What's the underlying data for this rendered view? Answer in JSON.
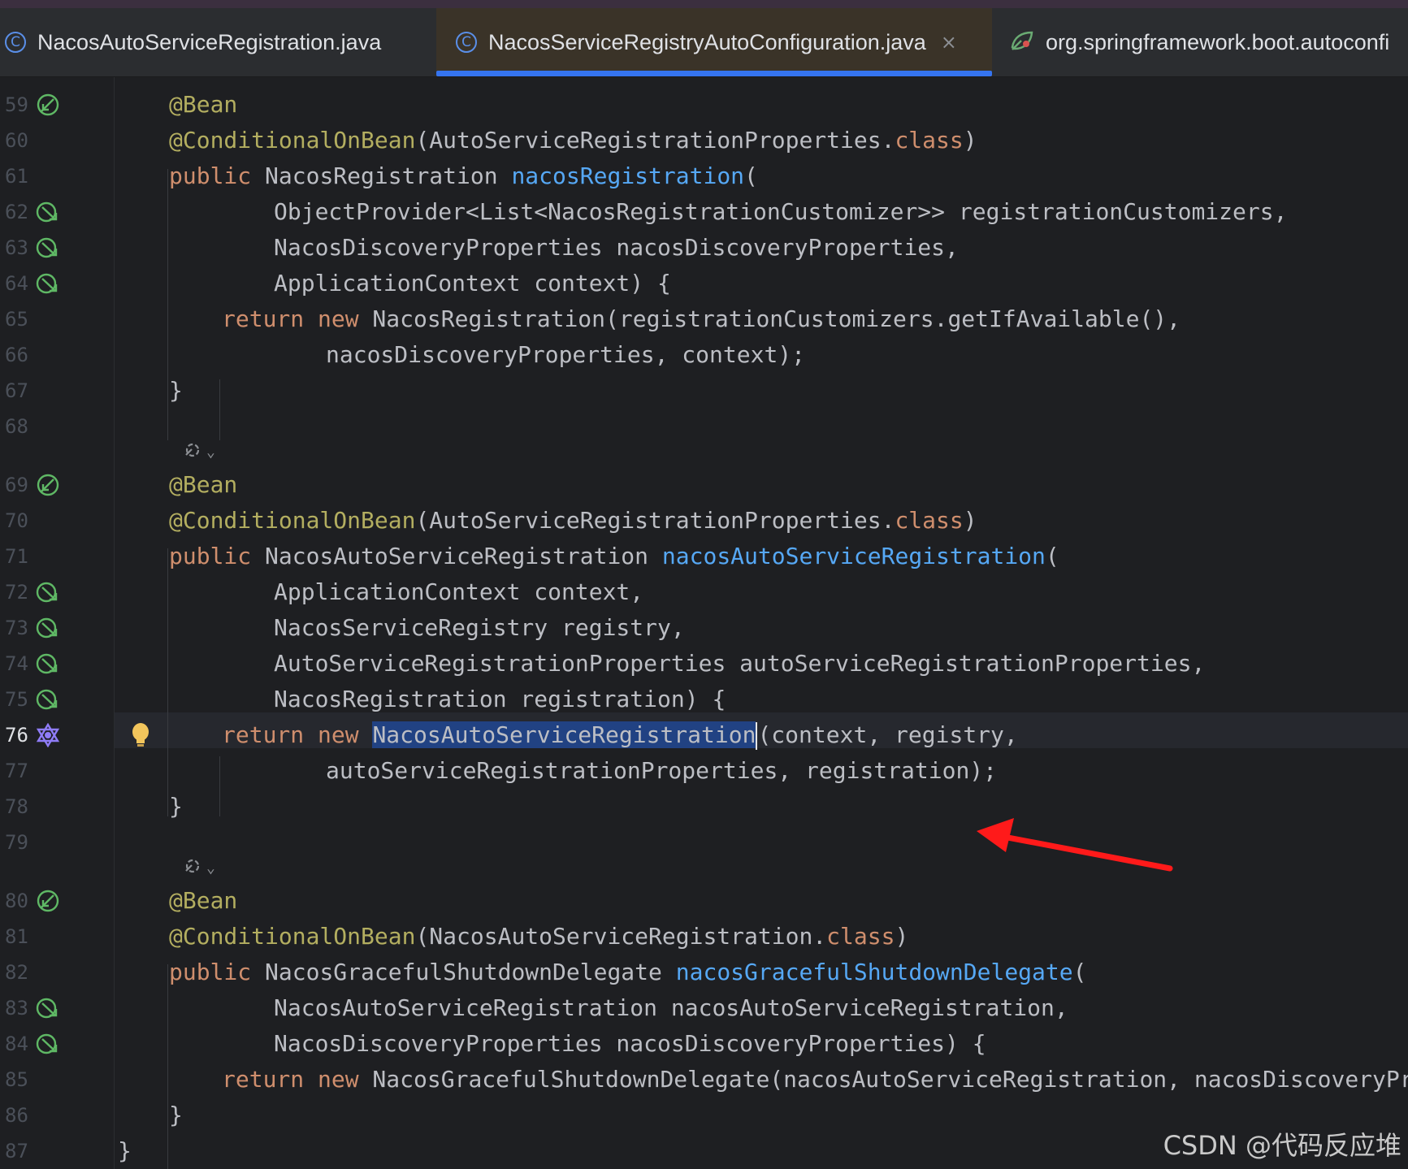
{
  "tabs": [
    {
      "label": "NacosAutoServiceRegistration.java",
      "icon": "class-icon",
      "active": false
    },
    {
      "label": "NacosServiceRegistryAutoConfiguration.java",
      "icon": "class-icon",
      "active": true,
      "close": "×"
    },
    {
      "label": "org.springframework.boot.autoconfi",
      "icon": "spring-leaf-icon",
      "active": false
    }
  ],
  "editor": {
    "current_line": "76",
    "lines": [
      {
        "n": "59",
        "icon": "bean-icon"
      },
      {
        "n": "60"
      },
      {
        "n": "61"
      },
      {
        "n": "62",
        "icon": "inject-icon"
      },
      {
        "n": "63",
        "icon": "inject-icon"
      },
      {
        "n": "64",
        "icon": "inject-icon"
      },
      {
        "n": "65"
      },
      {
        "n": "66"
      },
      {
        "n": "67"
      },
      {
        "n": "68"
      },
      {
        "n": "69",
        "icon": "bean-icon"
      },
      {
        "n": "70"
      },
      {
        "n": "71"
      },
      {
        "n": "72",
        "icon": "inject-icon"
      },
      {
        "n": "73",
        "icon": "inject-icon"
      },
      {
        "n": "74",
        "icon": "inject-icon"
      },
      {
        "n": "75",
        "icon": "inject-icon"
      },
      {
        "n": "76",
        "icon": "implementation-icon"
      },
      {
        "n": "77"
      },
      {
        "n": "78"
      },
      {
        "n": "79"
      },
      {
        "n": "80",
        "icon": "bean-icon"
      },
      {
        "n": "81"
      },
      {
        "n": "82"
      },
      {
        "n": "83",
        "icon": "inject-icon"
      },
      {
        "n": "84",
        "icon": "inject-icon"
      },
      {
        "n": "85"
      },
      {
        "n": "86"
      },
      {
        "n": "87"
      }
    ],
    "code": {
      "l59": {
        "ann": "@Bean"
      },
      "l60": {
        "ann": "@ConditionalOnBean",
        "t1": "(AutoServiceRegistrationProperties.",
        "kw": "class",
        "t2": ")"
      },
      "l61": {
        "kw": "public",
        "t1": " NacosRegistration ",
        "fn": "nacosRegistration",
        "t2": "("
      },
      "l62": {
        "t": "ObjectProvider<List<NacosRegistrationCustomizer>> registrationCustomizers,"
      },
      "l63": {
        "t": "NacosDiscoveryProperties nacosDiscoveryProperties,"
      },
      "l64": {
        "t": "ApplicationContext context) {"
      },
      "l65": {
        "kw": "return new",
        "t": " NacosRegistration(registrationCustomizers.getIfAvailable(),"
      },
      "l66": {
        "t": "nacosDiscoveryProperties, context);"
      },
      "l67": {
        "t": "}"
      },
      "l69": {
        "ann": "@Bean"
      },
      "l70": {
        "ann": "@ConditionalOnBean",
        "t1": "(AutoServiceRegistrationProperties.",
        "kw": "class",
        "t2": ")"
      },
      "l71": {
        "kw": "public",
        "t1": " NacosAutoServiceRegistration ",
        "fn": "nacosAutoServiceRegistration",
        "t2": "("
      },
      "l72": {
        "t": "ApplicationContext context,"
      },
      "l73": {
        "t": "NacosServiceRegistry registry,"
      },
      "l74": {
        "t": "AutoServiceRegistrationProperties autoServiceRegistrationProperties,"
      },
      "l75": {
        "t": "NacosRegistration registration) {"
      },
      "l76": {
        "kw": "return new",
        "sp": " ",
        "sel": "NacosAutoServiceRegistration",
        "t": "(context, registry,"
      },
      "l77": {
        "t": "autoServiceRegistrationProperties, registration);"
      },
      "l78": {
        "t": "}"
      },
      "l80": {
        "ann": "@Bean"
      },
      "l81": {
        "ann": "@ConditionalOnBean",
        "t1": "(NacosAutoServiceRegistration.",
        "kw": "class",
        "t2": ")"
      },
      "l82": {
        "kw": "public",
        "t1": " NacosGracefulShutdownDelegate ",
        "fn": "nacosGracefulShutdownDelegate",
        "t2": "("
      },
      "l83": {
        "t": "NacosAutoServiceRegistration nacosAutoServiceRegistration,"
      },
      "l84": {
        "t": "NacosDiscoveryProperties nacosDiscoveryProperties) {"
      },
      "l85": {
        "kw": "return new",
        "t": " NacosGracefulShutdownDelegate(nacosAutoServiceRegistration, nacosDiscoveryProper"
      },
      "l86": {
        "t": "}"
      },
      "l87": {
        "t": "}"
      }
    },
    "inlay_hint_icon": "spring-bean-hint-icon",
    "inlay_chevron": "⌄"
  },
  "watermark": "CSDN @代码反应堆",
  "colors": {
    "keyword": "#cf8e6d",
    "annotation": "#b3ae60",
    "function": "#56a8f5",
    "text": "#bcbec4",
    "selection": "#214283",
    "accent": "#3574f0",
    "arrow": "#ff1a1a"
  }
}
